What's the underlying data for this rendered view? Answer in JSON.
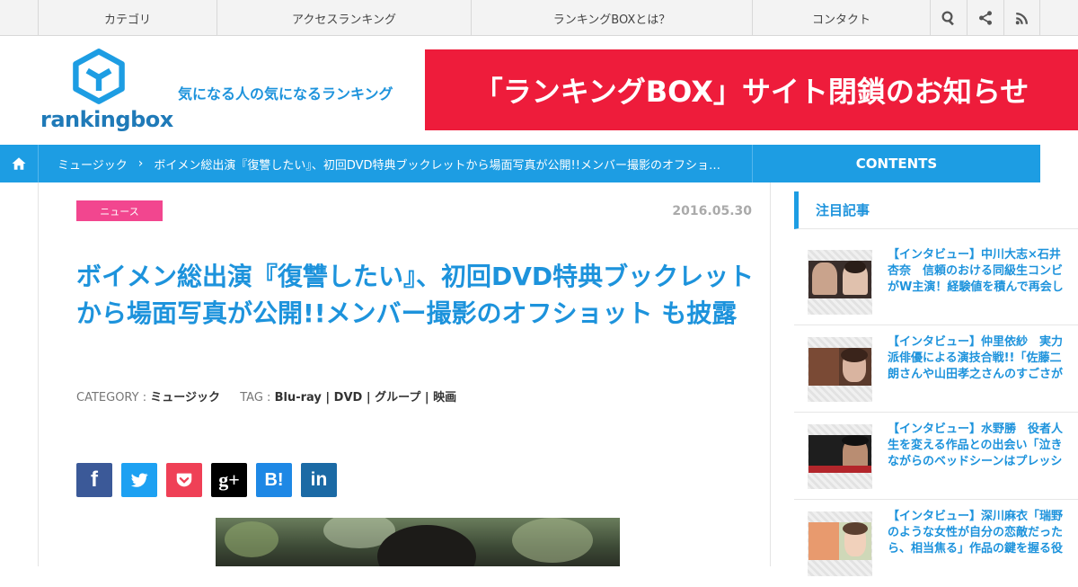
{
  "topnav": {
    "items": [
      "カテゴリ",
      "アクセスランキング",
      "ランキングBOXとは？",
      "コンタクト"
    ],
    "icons": [
      "search-icon",
      "share-icon",
      "rss-icon"
    ]
  },
  "header": {
    "logo_text": "rankingbox",
    "tagline": "気になる人の気になるランキング",
    "banner": "「ランキングBOX」サイト閉鎖のお知らせ",
    "banner_color": "#ee1c3b"
  },
  "breadcrumb": {
    "category": "ミュージック",
    "current": "ボイメン総出演『復讐したい』、初回DVD特典ブックレットから場面写真が公開!!メンバー撮影のオフショ…",
    "contents_label": "CONTENTS"
  },
  "article": {
    "badge": "ニュース",
    "date": "2016.05.30",
    "title": "ボイメン総出演『復讐したい』、初回DVD特典ブックレットから場面写真が公開!!メンバー撮影のオフショット も披露",
    "category_label": "CATEGORY :",
    "category": "ミュージック",
    "tag_label": "TAG :",
    "tags": "Blu-ray | DVD | グループ | 映画",
    "share": [
      {
        "name": "facebook",
        "label": "f",
        "color": "#3b5998"
      },
      {
        "name": "twitter",
        "label": "t",
        "color": "#1da1f2"
      },
      {
        "name": "pocket",
        "label": "p",
        "color": "#ef4056"
      },
      {
        "name": "googleplus",
        "label": "g+",
        "color": "#000000"
      },
      {
        "name": "hatena",
        "label": "B!",
        "color": "#1e88e5"
      },
      {
        "name": "linkedin",
        "label": "in",
        "color": "#1b6aa5"
      }
    ]
  },
  "sidebar": {
    "heading": "注目記事",
    "items": [
      {
        "text": "【インタビュー】中川大志×石井杏奈　信頼のおける同級生コンビがW主演！経験値を積んで再会し"
      },
      {
        "text": "【インタビュー】仲里依紗　実力派俳優による演技合戦!!「佐藤二朗さんや山田孝之さんのすごさが"
      },
      {
        "text": "【インタビュー】水野勝　役者人生を変える作品との出会い「泣きながらのベッドシーンはプレッシ"
      },
      {
        "text": "【インタビュー】深川麻衣「瑞野のような女性が自分の恋敵だったら、相当焦る」作品の鍵を握る役"
      }
    ]
  }
}
